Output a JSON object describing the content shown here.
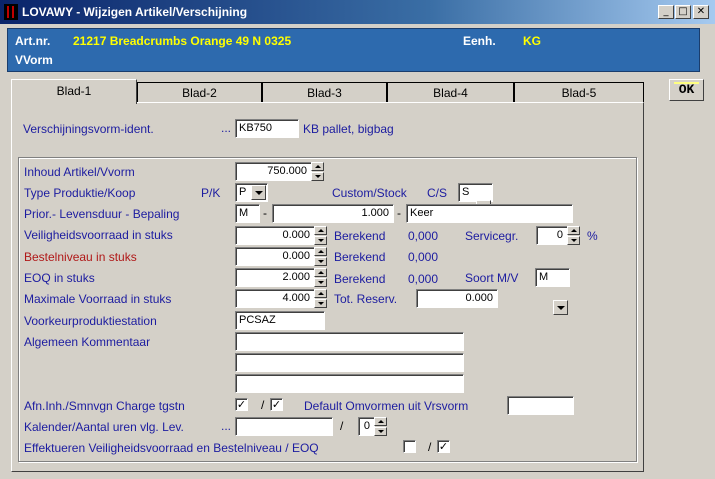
{
  "window": {
    "title": "LOVAWY - Wijzigen Artikel/Verschijning",
    "controls": [
      "_",
      "□",
      "✕"
    ]
  },
  "header": {
    "art_label": "Art.nr.",
    "art_value": "21217  Breadcrumbs Orange 49 N 0325",
    "unit_label": "Eenh.",
    "unit_value": "KG",
    "vvorm_label": "VVorm"
  },
  "tabs": [
    "Blad-1",
    "Blad-2",
    "Blad-3",
    "Blad-4",
    "Blad-5"
  ],
  "ok_label": "OK",
  "form": {
    "vvorm_ident": {
      "label": "Verschijningsvorm-ident.",
      "dots": "...",
      "value": "KB750",
      "desc": "KB pallet, bigbag"
    },
    "inhoud": {
      "label": "Inhoud Artikel/Vvorm",
      "value": "750.000"
    },
    "type_prod": {
      "label": "Type Produktie/Koop",
      "pk_label": "P/K",
      "pk_value": "P",
      "cs_label": "Custom/Stock",
      "cs_short": "C/S",
      "cs_value": "S"
    },
    "prior": {
      "label": "Prior.- Levensduur - Bepaling",
      "val1": "M",
      "dash1": "-",
      "val2": "1.000",
      "dash2": "-",
      "val3": "Keer"
    },
    "veilig": {
      "label": "Veiligheidsvoorraad in stuks",
      "value": "0.000",
      "berekend_label": "Berekend",
      "berekend_value": "0,000",
      "service_label": "Servicegr.",
      "service_value": "0",
      "pct": "%"
    },
    "bestel": {
      "label": "Bestelniveau in stuks",
      "value": "0.000",
      "berekend_label": "Berekend",
      "berekend_value": "0,000"
    },
    "eoq": {
      "label": "EOQ in stuks",
      "value": "2.000",
      "berekend_label": "Berekend",
      "berekend_value": "0,000",
      "soort_label": "Soort M/V",
      "soort_value": "M"
    },
    "maxvr": {
      "label": "Maximale Voorraad in stuks",
      "value": "4.000",
      "reserv_label": "Tot. Reserv.",
      "reserv_value": "0.000"
    },
    "voorkeur": {
      "label": "Voorkeurproduktiestation",
      "value": "PCSAZ"
    },
    "kommentaar": {
      "label": "Algemeen Kommentaar",
      "lines": [
        "",
        "",
        ""
      ]
    },
    "afn": {
      "label": "Afn.Inh./Smnvgn Charge tgstn",
      "check1": "✓",
      "slash": "/",
      "check2": "✓",
      "default_label": "Default Omvormen uit Vrsvorm",
      "default_value": ""
    },
    "kalender": {
      "label": "Kalender/Aantal uren vlg. Lev.",
      "dots": "...",
      "value": "",
      "slash": "/",
      "uren": "0"
    },
    "effekt": {
      "label": "Effektueren Veiligheidsvoorraad en Bestelniveau / EOQ",
      "check1": "",
      "slash": "/",
      "check2": "✓"
    }
  }
}
